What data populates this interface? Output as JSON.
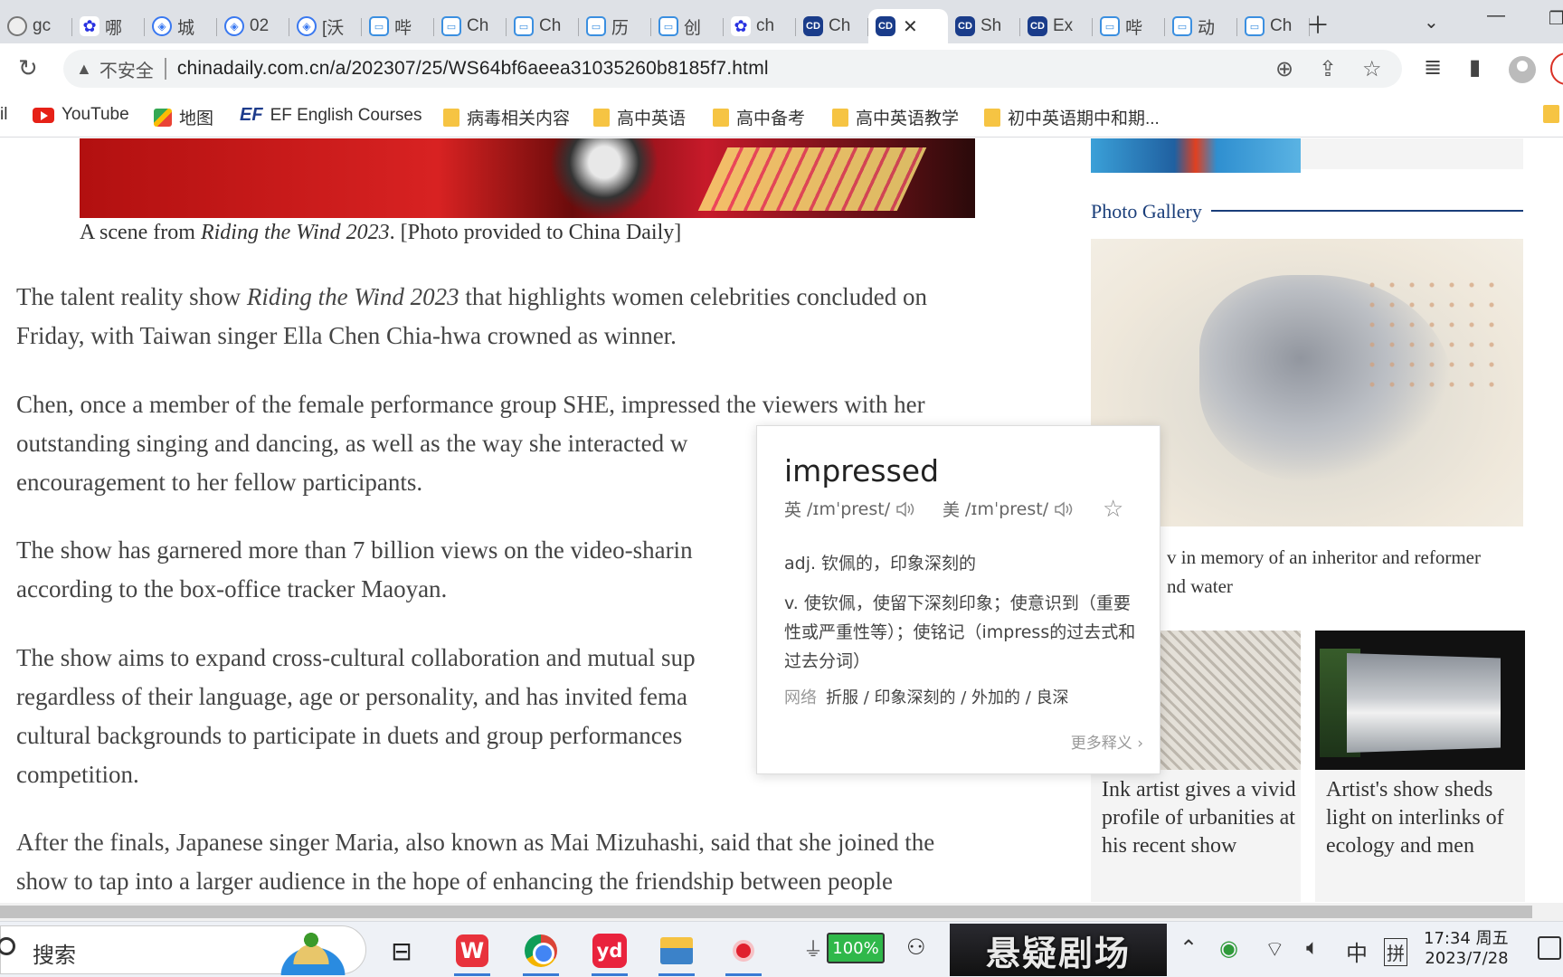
{
  "browser": {
    "tabs": [
      {
        "icon": "globe-icon",
        "title": "gc"
      },
      {
        "icon": "baidu-icon",
        "title": "哪"
      },
      {
        "icon": "hex-icon",
        "title": "城"
      },
      {
        "icon": "hex-icon",
        "title": "02"
      },
      {
        "icon": "hex-icon",
        "title": "[沃"
      },
      {
        "icon": "bilibili-icon",
        "title": "哔"
      },
      {
        "icon": "bilibili-icon",
        "title": "Ch"
      },
      {
        "icon": "bilibili-icon",
        "title": "Ch"
      },
      {
        "icon": "bilibili-icon",
        "title": "历"
      },
      {
        "icon": "bilibili-icon",
        "title": "创"
      },
      {
        "icon": "baidu-icon",
        "title": "ch"
      },
      {
        "icon": "chinadaily-icon",
        "title": "Ch"
      },
      {
        "icon": "chinadaily-icon",
        "title": "",
        "active": true
      },
      {
        "icon": "chinadaily-icon",
        "title": "Sh"
      },
      {
        "icon": "chinadaily-icon",
        "title": "Ex"
      },
      {
        "icon": "bilibili-icon",
        "title": "哔"
      },
      {
        "icon": "bilibili-icon",
        "title": "动"
      },
      {
        "icon": "bilibili-icon",
        "title": "Ch"
      }
    ],
    "address": {
      "security_label": "不安全",
      "url": "chinadaily.com.cn/a/202307/25/WS64bf6aeea31035260b8185f7.html"
    },
    "bookmarks": {
      "partial": "il",
      "youtube": "YouTube",
      "map": "地图",
      "ef_logo": "EF",
      "ef": "EF English Courses",
      "folder1": "病毒相关内容",
      "folder2": "高中英语",
      "folder3": "高中备考",
      "folder4": "高中英语教学",
      "folder5": "初中英语期中和期..."
    }
  },
  "article": {
    "caption_prefix": "A scene from ",
    "caption_title": "Riding the Wind 2023",
    "caption_suffix": ". [Photo provided to China Daily]",
    "p1": {
      "l1_a": "The talent reality show ",
      "l1_title": "Riding the Wind 2023",
      "l1_b": " that highlights women celebrities concluded on",
      "l2": "Friday, with Taiwan singer Ella Chen Chia-hwa crowned as winner."
    },
    "p2": [
      "Chen, once a member of the female performance group SHE, impressed the viewers with her",
      "outstanding singing and dancing, as well as the way she interacted w",
      "encouragement to her fellow participants."
    ],
    "p3": [
      "The show has garnered more than 7 billion views on the video-sharin",
      "according to the box-office tracker Maoyan."
    ],
    "p4": [
      "The show aims to expand cross-cultural collaboration and mutual sup",
      "regardless of their language, age or personality, and has invited fema",
      "cultural backgrounds to participate in duets and group performances",
      "competition."
    ],
    "p5": [
      "After the finals, Japanese singer Maria, also known as Mai Mizuhashi, said that she joined the",
      "show to tap into a larger audience in the hope of enhancing the friendship between people"
    ]
  },
  "sidebar": {
    "gallery_title": "Photo Gallery",
    "main_caption_l1": "v in memory of an inheritor and reformer",
    "main_caption_l2": "nd water",
    "card1": "Ink artist gives a vivid profile of urbanities at his recent show",
    "card2": "Artist's show sheds light on interlinks of ecology and men"
  },
  "dictionary": {
    "word": "impressed",
    "uk_label": "英",
    "uk_pron": "/ɪmˈprest/",
    "us_label": "美",
    "us_pron": "/ɪmˈprest/",
    "def_adj": "adj. 钦佩的，印象深刻的",
    "def_v": "v. 使钦佩，使留下深刻印象；使意识到（重要性或严重性等）；使铭记（impress的过去式和过去分词）",
    "web_label": "网络",
    "web_defs": "折服 / 印象深刻的 / 外加的 / 良深",
    "more": "更多释义"
  },
  "taskbar": {
    "search_placeholder": "搜索",
    "battery": "100%",
    "banner": "悬疑剧场",
    "ime_lang": "中",
    "ime_mode": "拼",
    "time": "17:34 周五",
    "date": "2023/7/28"
  },
  "colors": {
    "tabstrip": "#dee1e6",
    "link_blue": "#1a3e7a",
    "wps_red": "#e8323c",
    "battery_green": "#2fb84a"
  }
}
